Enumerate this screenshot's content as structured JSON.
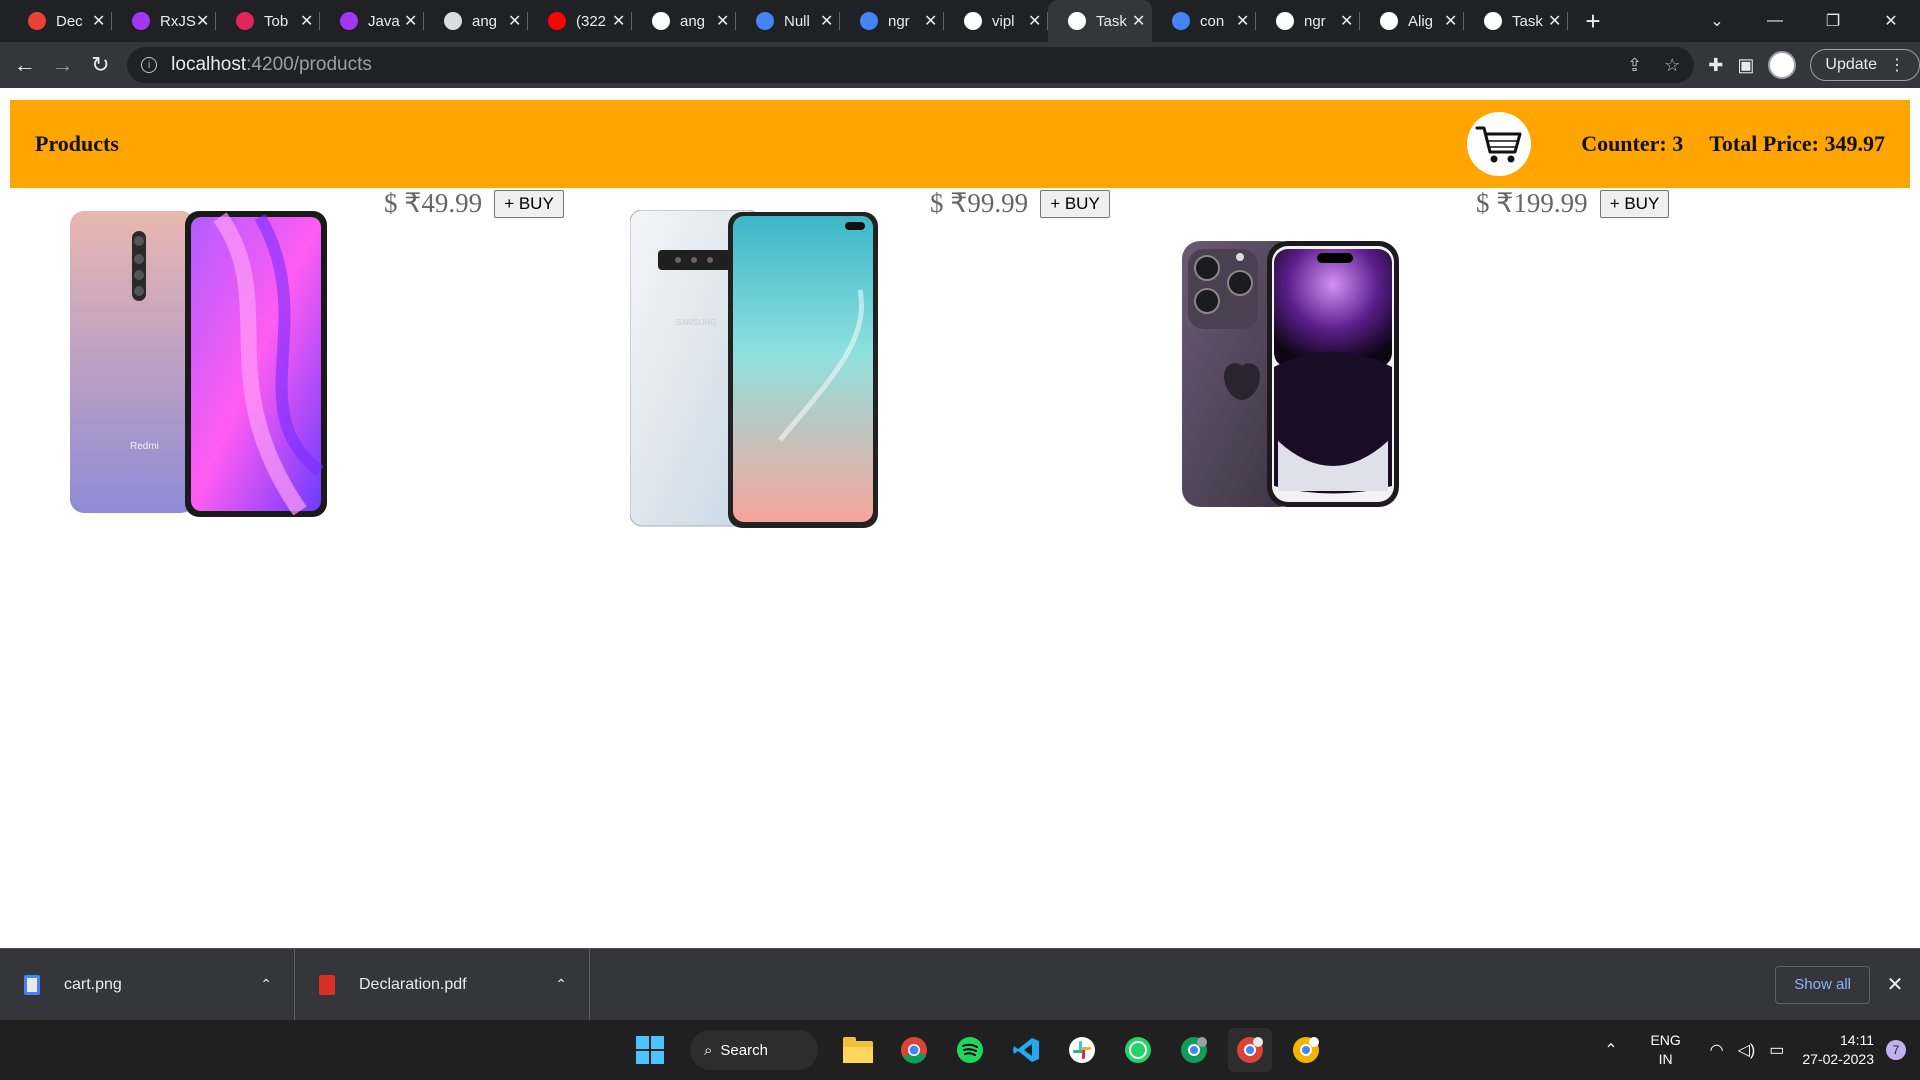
{
  "browser": {
    "tabs": [
      {
        "title": "Dec",
        "icon": "gmail-icon",
        "color": "#ea4335"
      },
      {
        "title": "RxJS",
        "icon": "udemy-icon",
        "color": "#a435f0"
      },
      {
        "title": "Tob",
        "icon": "t-app-icon",
        "color": "#e0245e"
      },
      {
        "title": "Java",
        "icon": "udemy-icon",
        "color": "#a435f0"
      },
      {
        "title": "ang",
        "icon": "globe-icon",
        "color": "#dadce0"
      },
      {
        "title": "(322",
        "icon": "youtube-icon",
        "color": "#ff0000"
      },
      {
        "title": "ang",
        "icon": "github-icon",
        "color": "#ffffff"
      },
      {
        "title": "Null",
        "icon": "google-icon",
        "color": "#4285f4"
      },
      {
        "title": "ngr",
        "icon": "google-icon",
        "color": "#4285f4"
      },
      {
        "title": "vipl",
        "icon": "github-icon",
        "color": "#ffffff"
      },
      {
        "title": "Task",
        "icon": "angular-icon",
        "color": "#ffffff",
        "active": true
      },
      {
        "title": "con",
        "icon": "google-icon",
        "color": "#4285f4"
      },
      {
        "title": "ngr",
        "icon": "github-icon",
        "color": "#ffffff"
      },
      {
        "title": "Alig",
        "icon": "medium-icon",
        "color": "#ffffff"
      },
      {
        "title": "Task",
        "icon": "angular-icon",
        "color": "#ffffff"
      }
    ],
    "new_tab": "+",
    "address": {
      "host": "localhost",
      "path": ":4200/products"
    },
    "update_label": "Update"
  },
  "app": {
    "brand": "Products",
    "counter_label": "Counter: 3",
    "total_label": "Total Price: 349.97",
    "accent": "#ffa500",
    "products": [
      {
        "price": "$ ₹49.99",
        "buy": "+ BUY",
        "image": "redmi-phone"
      },
      {
        "price": "$ ₹99.99",
        "buy": "+ BUY",
        "image": "samsung-phone"
      },
      {
        "price": "$ ₹199.99",
        "buy": "+ BUY",
        "image": "iphone-phone"
      }
    ]
  },
  "downloads": {
    "items": [
      {
        "name": "cart.png",
        "icon": "image-file-icon"
      },
      {
        "name": "Declaration.pdf",
        "icon": "pdf-file-icon"
      }
    ],
    "show_all": "Show all"
  },
  "taskbar": {
    "search_label": "Search",
    "lang_top": "ENG",
    "lang_bottom": "IN",
    "time": "14:11",
    "date": "27-02-2023",
    "notification_count": "7"
  }
}
